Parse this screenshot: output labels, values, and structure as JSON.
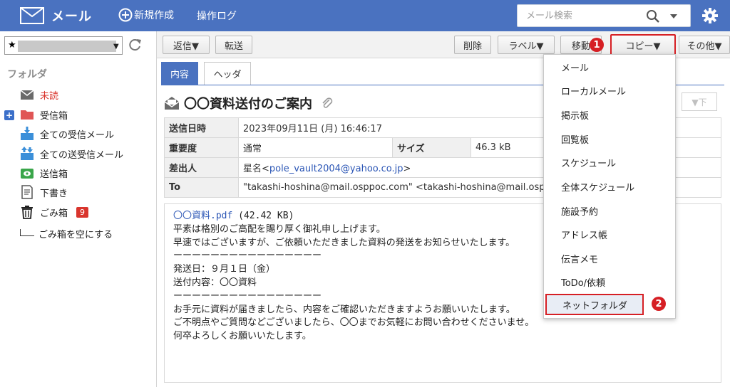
{
  "header": {
    "app_title": "メール",
    "new_label": "新規作成",
    "oplog_label": "操作ログ",
    "search_placeholder": "メール検索"
  },
  "sidebar": {
    "account_star": "★",
    "folder_heading": "フォルダ",
    "items": [
      {
        "label": "未読"
      },
      {
        "label": "受信箱"
      },
      {
        "label": "全ての受信メール"
      },
      {
        "label": "全ての送受信メール"
      },
      {
        "label": "送信箱"
      },
      {
        "label": "下書き"
      },
      {
        "label": "ごみ箱",
        "badge": "9"
      }
    ],
    "empty_trash": "ごみ箱を空にする"
  },
  "toolbar": {
    "reply": "返信▼",
    "forward": "転送",
    "delete": "削除",
    "label": "ラベル▼",
    "move": "移動",
    "copy": "コピー▼",
    "other": "その他▼",
    "badge1": "1",
    "badge2": "2"
  },
  "tabs": {
    "content": "内容",
    "header": "ヘッダ"
  },
  "message": {
    "subject": "〇〇資料送付のご案内",
    "down_label": "▼下",
    "rows": {
      "date_label": "送信日時",
      "date_value": "2023年09月11日 (月) 16:46:17",
      "priority_label": "重要度",
      "priority_value": "通常",
      "size_label": "サイズ",
      "size_value": "46.3 kB",
      "from_label": "差出人",
      "from_name": "星名<",
      "from_email": "pole_vault2004@yahoo.co.jp",
      "from_close": ">",
      "to_label": "To",
      "to_value": "\"takashi-hoshina@mail.osppoc.com\" <takashi-hoshina@mail.osp"
    },
    "attachment_name": "〇〇資料.pdf",
    "attachment_size": " (42.42 KB)",
    "body_lines": [
      "平素は格別のご高配を賜り厚く御礼申し上げます。",
      "早速ではございますが、ご依頼いただきました資料の発送をお知らせいたします。",
      "",
      "ーーーーーーーーーーーーーーーー",
      "発送日：９月１日（金）",
      "送付内容：〇〇資料",
      "ーーーーーーーーーーーーーーーー",
      "",
      "お手元に資料が届きましたら、内容をご確認いただきますようお願いいたします。",
      "ご不明点やご質問などございましたら、〇〇までお気軽にお問い合わせくださいませ。",
      "何卒よろしくお願いいたします。"
    ]
  },
  "copy_menu": {
    "items": [
      {
        "label": "メール"
      },
      {
        "label": "ローカルメール"
      },
      {
        "label": "掲示板"
      },
      {
        "label": "回覧板"
      },
      {
        "label": "スケジュール"
      },
      {
        "label": "全体スケジュール"
      },
      {
        "label": "施設予約"
      },
      {
        "label": "アドレス帳"
      },
      {
        "label": "伝言メモ"
      },
      {
        "label": "ToDo/依頼"
      },
      {
        "label": "ネットフォルダ"
      }
    ]
  },
  "colors": {
    "header_bg": "#4a72c0",
    "highlight": "#d61f24",
    "link": "#2a55b5"
  }
}
